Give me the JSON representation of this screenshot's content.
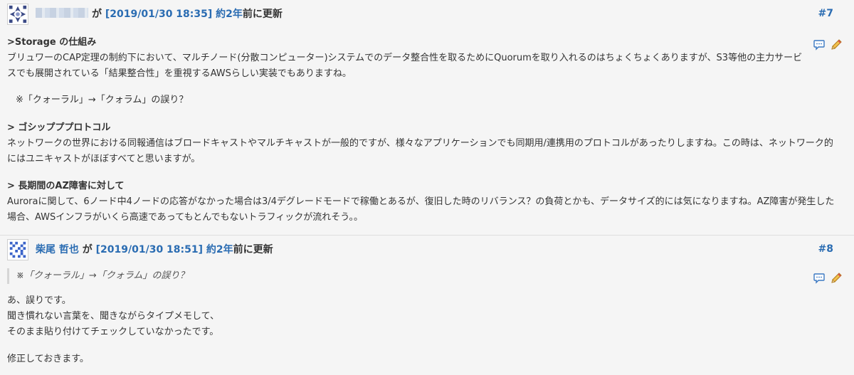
{
  "journals": [
    {
      "author": "",
      "by": "が",
      "datetime": "[2019/01/30 18:35]",
      "ago": "約2年",
      "updated": "前に更新",
      "number": "#7",
      "sections": {
        "s1_heading": ">Storage の仕組み",
        "s1_line1": "ブリュワーのCAP定理の制約下において、マルチノード(分散コンピューター)システムでのデータ整合性を取るためにQuorumを取り入れるのはちょくちょくありますが、S3等他の主力サービ",
        "s1_line2": "スでも展開されている「結果整合性」を重視するAWSらしい実装でもありますね。",
        "s1_note": "※「クォーラル」→「クォラム」の誤り？",
        "s2_heading": "> ゴシップププロトコル",
        "s2_line1": "ネットワークの世界における同報通信はブロードキャストやマルチキャストが一般的ですが、様々なアプリケーションでも同期用/連携用のプロトコルがあったりしますね。この時は、ネットワーク的",
        "s2_line2": "にはユニキャストがほぼすべてと思いますが。",
        "s3_heading": "> 長期間のAZ障害に対して",
        "s3_line1": "Auroraに関して、6ノード中4ノードの応答がなかった場合は3/4デグレードモードで稼働とあるが、復旧した時のリバランス？の負荷とかも、データサイズ的には気になりますね。AZ障害が発生した",
        "s3_line2": "場合、AWSインフラがいくら高速であってもとんでもないトラフィックが流れそう。。"
      }
    },
    {
      "author": "柴尾 哲也",
      "by": "が",
      "datetime": "[2019/01/30 18:51]",
      "ago": "約2年",
      "updated": "前に更新",
      "number": "#8",
      "quote": "※「クォーラル」→「クォラム」の誤り？",
      "lines": {
        "l1": "あ、誤りです。",
        "l2": "聞き慣れない言葉を、聞きながらタイプメモして、",
        "l3": "そのまま貼り付けてチェックしていなかったです。",
        "l4": "修正しておきます。"
      }
    }
  ],
  "icons": {
    "quote": "speech-bubble-icon",
    "edit": "pencil-icon"
  },
  "colors": {
    "link": "#2a6cb2",
    "background": "#f5f5f5",
    "text": "#333333"
  }
}
